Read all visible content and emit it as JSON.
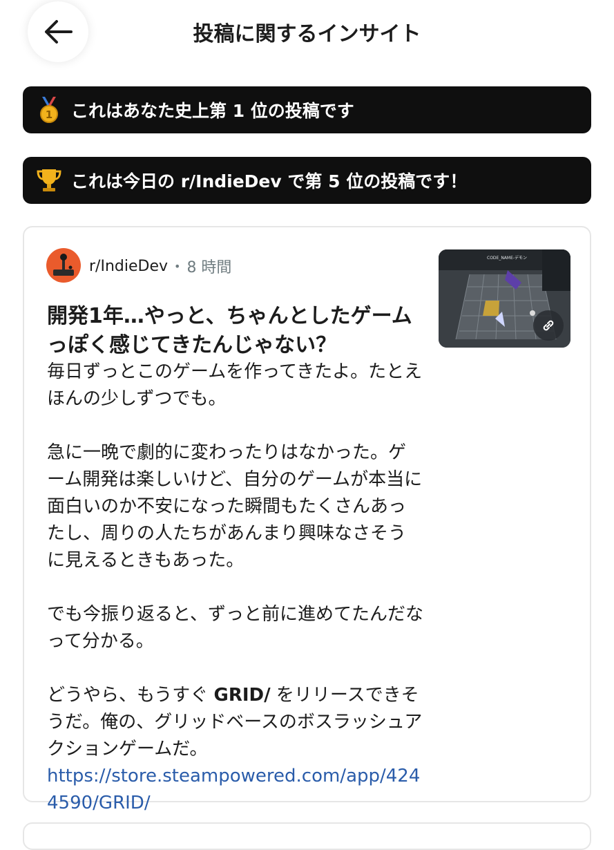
{
  "header": {
    "title": "投稿に関するインサイト"
  },
  "banners": [
    {
      "icon": "medal-icon",
      "text": "これはあなた史上第 1 位の投稿です"
    },
    {
      "icon": "trophy-icon",
      "text": "これは今日の r/IndieDev で第 5 位の投稿です！"
    }
  ],
  "post": {
    "subreddit": "r/IndieDev",
    "separator": "•",
    "time": "8 時間",
    "title": "開発1年…やっと、ちゃんとしたゲームっぽく感じてきたんじゃない？",
    "body": {
      "p1": "毎日ずっとこのゲームを作ってきたよ。たとえほんの少しずつでも。",
      "p2": "急に一晩で劇的に変わったりはなかった。ゲーム開発は楽しいけど、自分のゲームが本当に面白いのか不安になった瞬間もたくさんあったし、周りの人たちがあんまり興味なさそうに見えるときもあった。",
      "p3": "でも今振り返ると、ずっと前に進めてたんだなって分かる。",
      "p4_before": "どうやら、もうすぐ ",
      "p4_bold": "GRID/",
      "p4_after": " をリリースできそうだ。俺の、グリッドベースのボスラッシュアクションゲームだ。",
      "link": "https://store.steampowered.com/app/4244590/GRID/"
    },
    "thumbnail_label": "CODE_NAME-デモン"
  },
  "colors": {
    "banner_bg": "#0f0f0f",
    "link": "#2a5caa",
    "avatar": "#ea5b2c",
    "meta_gray": "#6f7c80"
  }
}
